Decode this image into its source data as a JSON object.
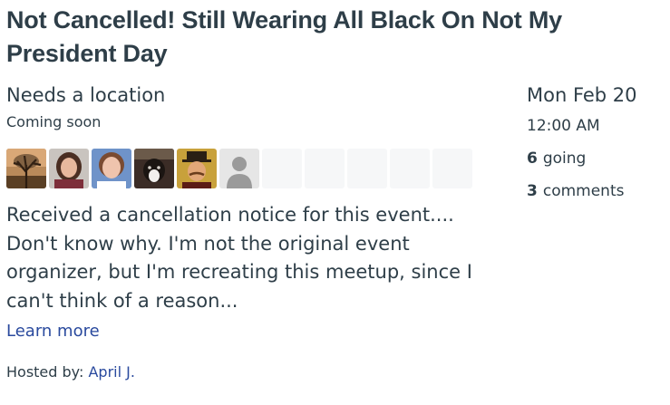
{
  "event": {
    "title": "Not Cancelled! Still Wearing All Black On Not My President Day",
    "location_name": "Needs a location",
    "location_status": "Coming soon",
    "description": "Received a cancellation notice for this event.... Don't know why. I'm not the original event organizer, but I'm recreating this meetup, since I can't think of a reason...",
    "learn_more": "Learn more",
    "hosted_by_label": "Hosted by:",
    "host_name": "April J."
  },
  "side": {
    "date": "Mon Feb 20",
    "time": "12:00 AM",
    "going_count": "6",
    "going_label": "going",
    "comments_count": "3",
    "comments_label": "comments"
  },
  "attendees": [
    {
      "icon": "tree-sunset-photo"
    },
    {
      "icon": "woman-photo"
    },
    {
      "icon": "woman-photo"
    },
    {
      "icon": "dog-photo"
    },
    {
      "icon": "man-hat-photo"
    },
    {
      "icon": "default-person-icon"
    },
    {
      "icon": "empty-slot"
    },
    {
      "icon": "empty-slot"
    },
    {
      "icon": "empty-slot"
    },
    {
      "icon": "empty-slot"
    },
    {
      "icon": "empty-slot"
    }
  ],
  "colors": {
    "text": "#2e3e48",
    "link": "#2a4a9e",
    "placeholder": "#f6f7f8"
  }
}
